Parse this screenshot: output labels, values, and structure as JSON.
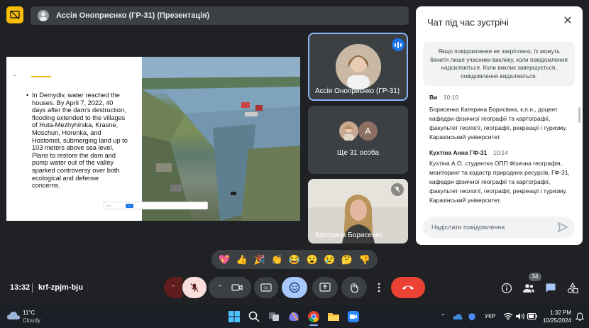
{
  "header": {
    "presenter_label": "Ассія Оноприєнко (ГР-31) (Презентація)"
  },
  "slide": {
    "bullet_text": "In Demydiv, water reached the houses. By April 7, 2022, 40 days after the dam's destruction, flooding extended to the villages of Huta-Mezhyhirska, Krasne, Moschun, Horenka, and Hostomel, submerging land up to 103 meters above sea level. Plans to restore the dam and pump water out of the valley sparked controversy over both ecological and defense concerns.",
    "bullet_symbol": "•",
    "accent_color": "#f4c20d"
  },
  "tiles": {
    "speaker_name": "Ассія Оноприєнко (ГР-31)",
    "others_initial": "A",
    "others_label": "Ще 31 особа",
    "third_name": "Катерина Борисенко"
  },
  "chat": {
    "title": "Чат під час зустрічі",
    "note": "Якщо повідомлення не закріплено, їх можуть бачити лише учасники виклику, коли повідомлення надсилаються. Коли виклик завершується, повідомлення видаляються.",
    "messages": [
      {
        "author": "Ви",
        "time": "10:10",
        "text": "Борисенко Катерина Борисівна, к.п.н., доцент кафедри фізичної географії та картографії, факультет геології, географії, рекреації і туризму. Каразінський університет."
      },
      {
        "author": "Кухтіна Анна ГФ-31",
        "time": "10:14",
        "text": "Кухтіна А.О. студентка ОПП Фізична географія, моніторинг та кадастр природних ресурсів, ГФ-31, кафедри фізичної географії та картографії, факультет геології, географії, рекреації і туризму. Каразінський університет."
      }
    ],
    "input_placeholder": "Надіслати повідомлення"
  },
  "reactions": [
    "💖",
    "👍",
    "🎉",
    "👏",
    "😂",
    "😮",
    "😢",
    "🤔",
    "👎"
  ],
  "controls": {
    "time": "13:32",
    "meeting_code": "krf-zpjm-bju",
    "participants_count": "34",
    "hangup_color": "#ea4335",
    "active_color": "#a8c7fa"
  },
  "taskbar": {
    "temperature": "11°C",
    "weather": "Cloudy",
    "language": "УКР",
    "time": "1:32 PM",
    "date": "10/25/2024"
  }
}
